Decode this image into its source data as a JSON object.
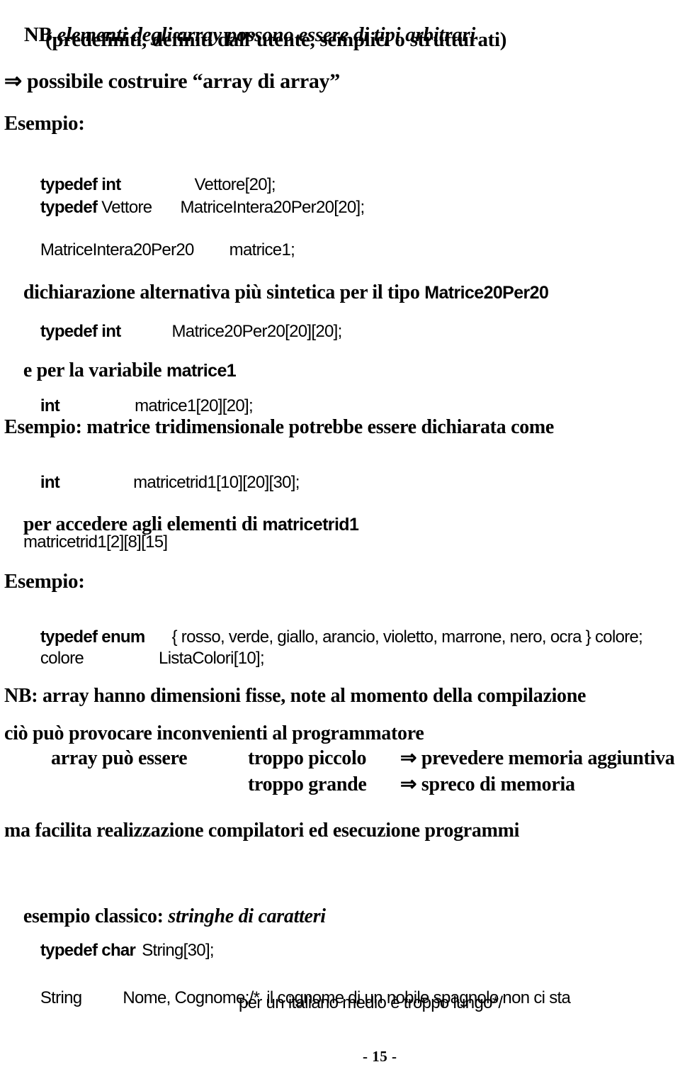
{
  "document": {
    "language": "it",
    "page_number_label": "- 15 -"
  },
  "lines": {
    "nb_prefix": "NB ",
    "nb_italic": "elementi degli array possono essere di tipi arbitrari",
    "nb_second": "(predefiniti, definiti dall’utente, semplici o strutturati)",
    "implies_array_di_array": "⇒ possibile costruire “array di array”",
    "esempio_1": "Esempio:",
    "dichiarazione_prefix": "dichiarazione alternativa più sintetica per il tipo ",
    "dichiarazione_code": "Matrice20Per20",
    "e_per_la_variabile_prefix": "e per la variabile ",
    "e_per_la_variabile_code": "matrice1",
    "esempio_tridimensionale": "Esempio: matrice tridimensionale potrebbe essere dichiarata come",
    "per_accedere_prefix": "per accedere agli elementi di ",
    "per_accedere_code": "matricetrid1",
    "esempio_2": "Esempio:",
    "nb_array_fisse": "NB: array hanno dimensioni fisse, note al momento della compilazione",
    "cio_puo_provocare": "ciò può provocare inconvenienti al programmatore",
    "array_puo_essere": "array può essere",
    "troppo_piccolo": "troppo piccolo",
    "troppo_piccolo_result": "⇒ prevedere memoria aggiuntiva",
    "troppo_grande": "troppo grande",
    "troppo_grande_result": "⇒ spreco di memoria",
    "ma_facilita": "ma facilita realizzazione compilatori ed esecuzione programmi",
    "esempio_classico_prefix": "esempio classico: ",
    "esempio_classico_italic": "stringhe di caratteri"
  },
  "code": {
    "typedef_int_kw": "typedef int",
    "vettore_decl": "Vettore[20];",
    "typedef_kw": "typedef",
    "vettore_type": " Vettore",
    "matriceintera_decl": "MatriceIntera20Per20[20];",
    "matriceintera_type": "MatriceIntera20Per20",
    "matrice1_var": "matrice1;",
    "typedef_int_kw2": "typedef int",
    "matrice20per20_decl": "Matrice20Per20[20][20];",
    "int_kw": "int",
    "matrice1_decl": "matrice1[20][20];",
    "int_kw2": "int",
    "matricetrid1_decl": "matricetrid1[10][20][30];",
    "matricetrid1_access": "matricetrid1[2][8][15]",
    "typedef_enum_kw": "typedef enum",
    "enum_body": "{ rosso, verde, giallo, arancio, violetto, marrone, nero, ocra } colore;",
    "colore_type": "colore",
    "listacolori_decl": "ListaColori[10];",
    "typedef_char_kw": "typedef char",
    "string_decl": "String[30];",
    "string_type": "String",
    "nome_cognome": "Nome, Cognome;/*",
    "comment_line1": "il cognome di un nobile spagnolo non ci sta",
    "comment_line2": "per un italiano medio è troppo lungo*/"
  }
}
